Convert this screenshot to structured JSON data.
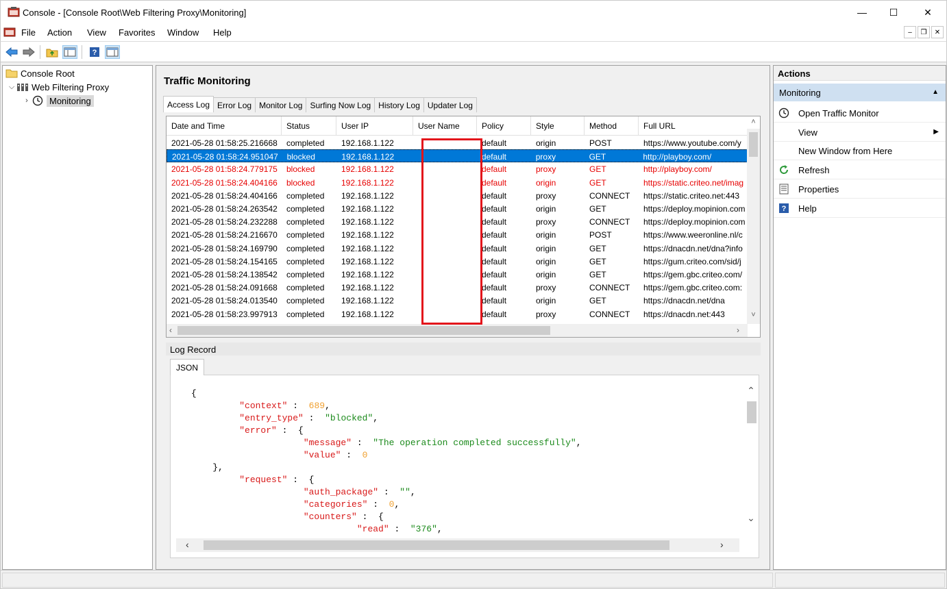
{
  "window": {
    "title": "Console - [Console Root\\Web Filtering Proxy\\Monitoring]",
    "min": "—",
    "max": "☐",
    "close": "✕"
  },
  "menu": {
    "items": [
      "File",
      "Action",
      "View",
      "Favorites",
      "Window",
      "Help"
    ]
  },
  "tree": {
    "root": "Console Root",
    "proxy": "Web Filtering Proxy",
    "monitoring": "Monitoring"
  },
  "center": {
    "title": "Traffic Monitoring",
    "tabs": [
      "Access Log",
      "Error Log",
      "Monitor Log",
      "Surfing Now Log",
      "History Log",
      "Updater Log"
    ],
    "columns": [
      "Date and Time",
      "Status",
      "User IP",
      "User Name",
      "Policy",
      "Style",
      "Method",
      "Full URL"
    ],
    "rows": [
      {
        "dt": "2021-05-28 01:58:25.216668",
        "status": "completed",
        "ip": "192.168.1.122",
        "user": "",
        "policy": "default",
        "style": "origin",
        "method": "POST",
        "url": "https://www.youtube.com/y"
      },
      {
        "dt": "2021-05-28 01:58:24.951047",
        "status": "blocked",
        "ip": "192.168.1.122",
        "user": "",
        "policy": "default",
        "style": "proxy",
        "method": "GET",
        "url": "http://playboy.com/"
      },
      {
        "dt": "2021-05-28 01:58:24.779175",
        "status": "blocked",
        "ip": "192.168.1.122",
        "user": "",
        "policy": "default",
        "style": "proxy",
        "method": "GET",
        "url": "http://playboy.com/"
      },
      {
        "dt": "2021-05-28 01:58:24.404166",
        "status": "blocked",
        "ip": "192.168.1.122",
        "user": "",
        "policy": "default",
        "style": "origin",
        "method": "GET",
        "url": "https://static.criteo.net/imag"
      },
      {
        "dt": "2021-05-28 01:58:24.404166",
        "status": "completed",
        "ip": "192.168.1.122",
        "user": "",
        "policy": "default",
        "style": "proxy",
        "method": "CONNECT",
        "url": "https://static.criteo.net:443"
      },
      {
        "dt": "2021-05-28 01:58:24.263542",
        "status": "completed",
        "ip": "192.168.1.122",
        "user": "",
        "policy": "default",
        "style": "origin",
        "method": "GET",
        "url": "https://deploy.mopinion.com"
      },
      {
        "dt": "2021-05-28 01:58:24.232288",
        "status": "completed",
        "ip": "192.168.1.122",
        "user": "",
        "policy": "default",
        "style": "proxy",
        "method": "CONNECT",
        "url": "https://deploy.mopinion.com"
      },
      {
        "dt": "2021-05-28 01:58:24.216670",
        "status": "completed",
        "ip": "192.168.1.122",
        "user": "",
        "policy": "default",
        "style": "origin",
        "method": "POST",
        "url": "https://www.weeronline.nl/c"
      },
      {
        "dt": "2021-05-28 01:58:24.169790",
        "status": "completed",
        "ip": "192.168.1.122",
        "user": "",
        "policy": "default",
        "style": "origin",
        "method": "GET",
        "url": "https://dnacdn.net/dna?info"
      },
      {
        "dt": "2021-05-28 01:58:24.154165",
        "status": "completed",
        "ip": "192.168.1.122",
        "user": "",
        "policy": "default",
        "style": "origin",
        "method": "GET",
        "url": "https://gum.criteo.com/sid/j"
      },
      {
        "dt": "2021-05-28 01:58:24.138542",
        "status": "completed",
        "ip": "192.168.1.122",
        "user": "",
        "policy": "default",
        "style": "origin",
        "method": "GET",
        "url": "https://gem.gbc.criteo.com/"
      },
      {
        "dt": "2021-05-28 01:58:24.091668",
        "status": "completed",
        "ip": "192.168.1.122",
        "user": "",
        "policy": "default",
        "style": "proxy",
        "method": "CONNECT",
        "url": "https://gem.gbc.criteo.com:"
      },
      {
        "dt": "2021-05-28 01:58:24.013540",
        "status": "completed",
        "ip": "192.168.1.122",
        "user": "",
        "policy": "default",
        "style": "origin",
        "method": "GET",
        "url": "https://dnacdn.net/dna"
      },
      {
        "dt": "2021-05-28 01:58:23.997913",
        "status": "completed",
        "ip": "192.168.1.122",
        "user": "",
        "policy": "default",
        "style": "proxy",
        "method": "CONNECT",
        "url": "https://dnacdn.net:443"
      }
    ],
    "log_record_label": "Log Record",
    "json_tab": "JSON",
    "json_lines": [
      [
        [
          "p",
          "{"
        ]
      ],
      [
        [
          "p",
          "         "
        ],
        [
          "k",
          "\"context\""
        ],
        [
          "p",
          " :  "
        ],
        [
          "n",
          "689"
        ],
        [
          "p",
          ","
        ]
      ],
      [
        [
          "p",
          "         "
        ],
        [
          "k",
          "\"entry_type\""
        ],
        [
          "p",
          " :  "
        ],
        [
          "s",
          "\"blocked\""
        ],
        [
          "p",
          ","
        ]
      ],
      [
        [
          "p",
          "         "
        ],
        [
          "k",
          "\"error\""
        ],
        [
          "p",
          " :  {"
        ]
      ],
      [
        [
          "p",
          "                     "
        ],
        [
          "k",
          "\"message\""
        ],
        [
          "p",
          " :  "
        ],
        [
          "s",
          "\"The operation completed successfully\""
        ],
        [
          "p",
          ","
        ]
      ],
      [
        [
          "p",
          "                     "
        ],
        [
          "k",
          "\"value\""
        ],
        [
          "p",
          " :  "
        ],
        [
          "n",
          "0"
        ]
      ],
      [
        [
          "p",
          "    },"
        ]
      ],
      [
        [
          "p",
          "         "
        ],
        [
          "k",
          "\"request\""
        ],
        [
          "p",
          " :  {"
        ]
      ],
      [
        [
          "p",
          "                     "
        ],
        [
          "k",
          "\"auth_package\""
        ],
        [
          "p",
          " :  "
        ],
        [
          "s",
          "\"\""
        ],
        [
          "p",
          ","
        ]
      ],
      [
        [
          "p",
          "                     "
        ],
        [
          "k",
          "\"categories\""
        ],
        [
          "p",
          " :  "
        ],
        [
          "n",
          "0"
        ],
        [
          "p",
          ","
        ]
      ],
      [
        [
          "p",
          "                     "
        ],
        [
          "k",
          "\"counters\""
        ],
        [
          "p",
          " :  {"
        ]
      ],
      [
        [
          "p",
          "                               "
        ],
        [
          "k",
          "\"read\""
        ],
        [
          "p",
          " :  "
        ],
        [
          "s",
          "\"376\""
        ],
        [
          "p",
          ","
        ]
      ]
    ]
  },
  "actions": {
    "title": "Actions",
    "section": "Monitoring",
    "items": [
      "Open Traffic Monitor",
      "View",
      "New Window from Here",
      "Refresh",
      "Properties",
      "Help"
    ]
  },
  "colors": {
    "selection": "#0078d7",
    "blocked_text": "#e60000",
    "highlight_box": "#e3141b",
    "section_bg": "#cfe0f1"
  }
}
